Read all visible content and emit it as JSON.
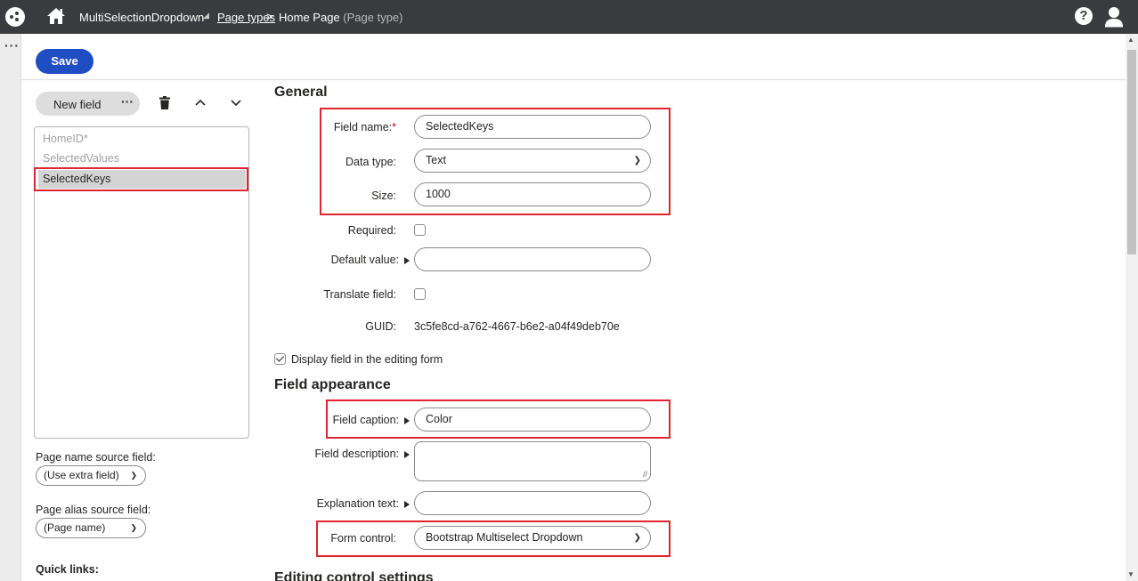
{
  "topbar": {
    "app_name": "MultiSelectionDropdown",
    "app_caret": "◢",
    "breadcrumb_link": "Page types",
    "breadcrumb_sep": ">",
    "breadcrumb_current": "Home Page",
    "breadcrumb_type": "(Page type)"
  },
  "rail": {
    "menu": "···"
  },
  "toolbar": {
    "save_label": "Save"
  },
  "field_panel": {
    "new_field_label": "New field",
    "more_label": "···",
    "fields": [
      {
        "name": "HomeID*",
        "selected": false
      },
      {
        "name": "SelectedValues",
        "selected": false
      },
      {
        "name": "SelectedKeys",
        "selected": true
      }
    ],
    "page_name_source_label": "Page name source field:",
    "page_name_source_value": "(Use extra field)",
    "page_alias_source_label": "Page alias source field:",
    "page_alias_source_value": "(Page name)",
    "quick_links_label": "Quick links:"
  },
  "general": {
    "title": "General",
    "field_name_label": "Field name:",
    "field_name_required": "*",
    "field_name_value": "SelectedKeys",
    "data_type_label": "Data type:",
    "data_type_value": "Text",
    "size_label": "Size:",
    "size_value": "1000",
    "required_label": "Required:",
    "required_checked": false,
    "default_value_label": "Default value:",
    "default_value": "",
    "translate_label": "Translate field:",
    "translate_checked": false,
    "guid_label": "GUID:",
    "guid_value": "3c5fe8cd-a762-4667-b6e2-a04f49deb70e",
    "display_field_label": "Display field in the editing form",
    "display_field_checked": true
  },
  "appearance": {
    "title": "Field appearance",
    "caption_label": "Field caption:",
    "caption_value": "Color",
    "description_label": "Field description:",
    "description_value": "",
    "explanation_label": "Explanation text:",
    "explanation_value": "",
    "form_control_label": "Form control:",
    "form_control_value": "Bootstrap Multiselect Dropdown"
  },
  "editing": {
    "title": "Editing control settings"
  },
  "colors": {
    "topbar_bg": "#3a3b3e",
    "primary_button": "#1f4ec2",
    "highlight_border": "#e02430",
    "selected_row": "#d4d4d4"
  },
  "icons": [
    "app-logo-icon",
    "home-icon",
    "help-icon",
    "user-icon",
    "trash-icon",
    "chevron-up-icon",
    "chevron-down-icon",
    "caret-right-icon"
  ]
}
